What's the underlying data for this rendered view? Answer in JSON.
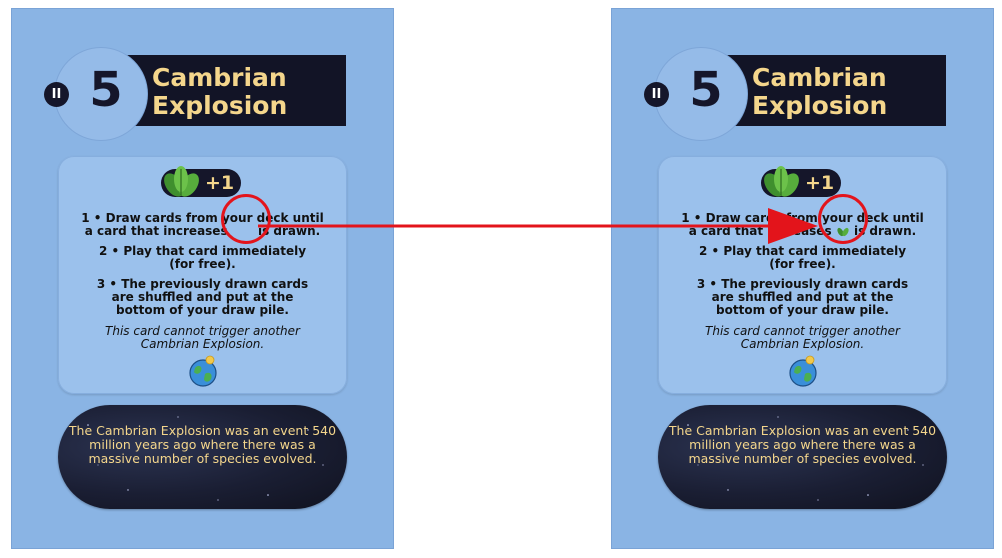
{
  "cards": [
    {
      "id": "left",
      "era": "II",
      "cost": "5",
      "title": "Cambrian\nExplosion",
      "bonus": "+1",
      "effect": {
        "line1a": "1 • Draw cards from your deck until",
        "line1b_pre": "a card that increases",
        "line1b_post": "is drawn.",
        "line2a": "2 • Play that card immediately",
        "line2b": "(for free).",
        "line3a": "3 • The previously drawn cards",
        "line3b": "are shuffled and put at the",
        "line3c": "bottom of your draw pile.",
        "note1": "This card cannot trigger another",
        "note2": "Cambrian Explosion."
      },
      "flavor": "The Cambrian Explosion was an event 540 million years ago where there was a massive number of species evolved.",
      "inline_icon_visible": false
    },
    {
      "id": "right",
      "era": "II",
      "cost": "5",
      "title": "Cambrian\nExplosion",
      "bonus": "+1",
      "effect": {
        "line1a": "1 • Draw cards from your deck until",
        "line1b_pre": "a card that increases",
        "line1b_post": "is drawn.",
        "line2a": "2 • Play that card immediately",
        "line2b": "(for free).",
        "line3a": "3 • The previously drawn cards",
        "line3b": "are shuffled and put at the",
        "line3c": "bottom of your draw pile.",
        "note1": "This card cannot trigger another",
        "note2": "Cambrian Explosion."
      },
      "flavor": "The Cambrian Explosion was an event 540 million years ago where there was a massive number of species evolved.",
      "inline_icon_visible": true
    }
  ],
  "colors": {
    "card_bg": "#8ab4e4",
    "title_bar": "#121426",
    "title_text": "#f4d68c",
    "annotation": "#e3141b"
  },
  "icons": {
    "era_badge": "era-badge-icon",
    "bonus": "leaf-icon",
    "category": "earth-icon",
    "annotation_arrow": "red-arrow-icon",
    "annotation_ring": "red-circle-icon"
  }
}
